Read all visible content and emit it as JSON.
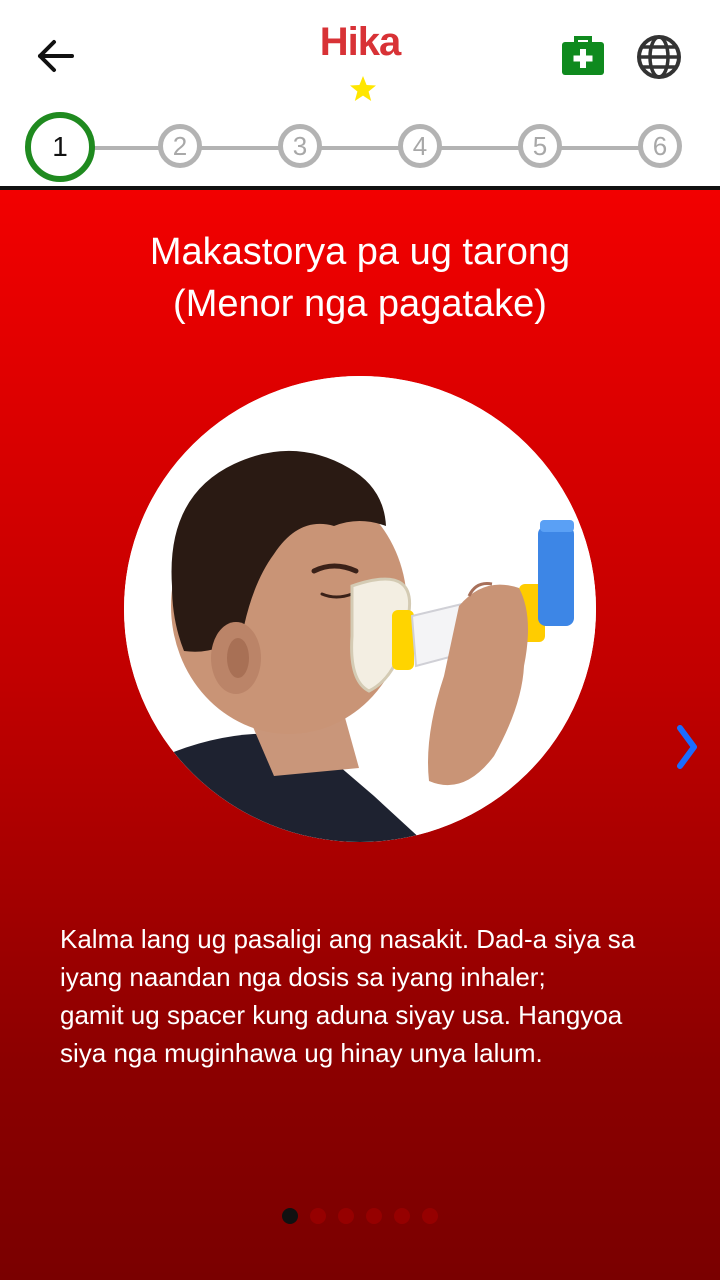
{
  "header": {
    "title": "Hika",
    "back_icon": "arrow-left-icon",
    "kit_icon": "first-aid-kit-icon",
    "globe_icon": "globe-icon",
    "kit_color": "#0f8a1e",
    "title_color": "#d83236",
    "star_color": "#ffe600"
  },
  "stepper": {
    "steps": [
      "1",
      "2",
      "3",
      "4",
      "5",
      "6"
    ],
    "current": "1",
    "active_color": "#1f8a1f",
    "inactive_color": "#b3b3b3"
  },
  "main": {
    "heading_line1": "Makastorya pa ug tarong",
    "heading_line2": "(Menor nga  pagatake)",
    "body_line1": "Kalma lang ug pasaligi ang nasakit. Dad-a siya sa",
    "body_line2": "iyang naandan nga dosis sa iyang inhaler;",
    "body_line3": "gamit ug spacer kung aduna siyay usa. Hangyoa",
    "body_line4": "siya nga muginhawa ug hinay unya lalum.",
    "background_color": "#d60000",
    "next_arrow_color": "#1a6cff"
  },
  "pagination": {
    "total": 6,
    "current": 1
  }
}
